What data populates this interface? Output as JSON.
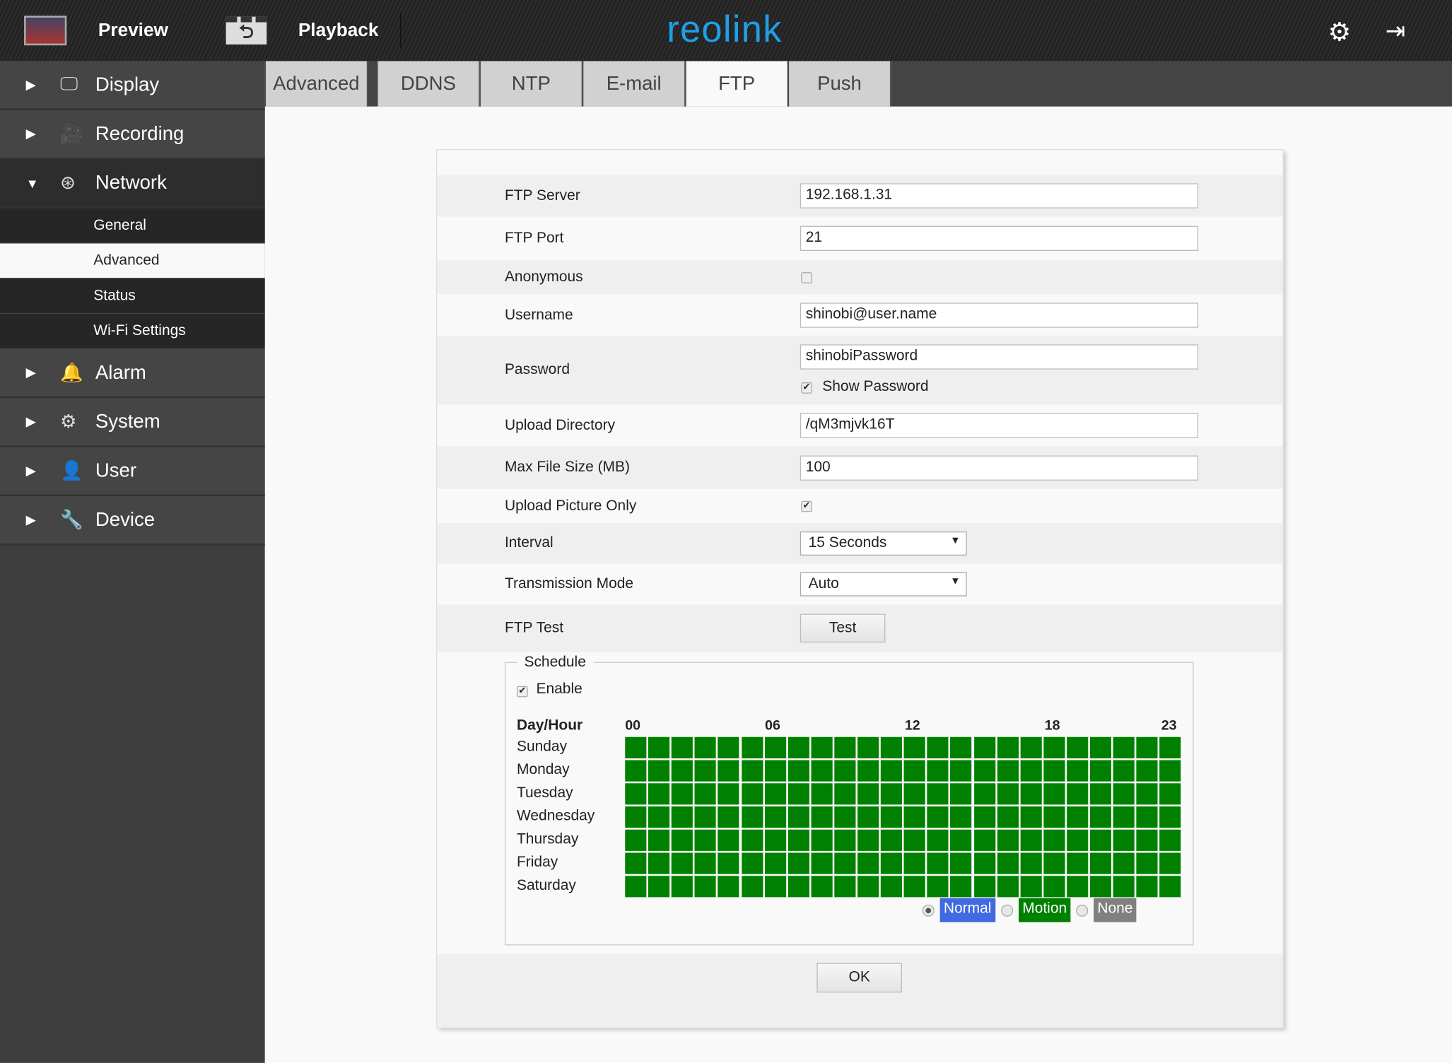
{
  "header": {
    "preview": "Preview",
    "playback": "Playback",
    "logo": "reolink"
  },
  "sidebar": {
    "items": [
      {
        "label": "Display",
        "icon": "monitor-icon"
      },
      {
        "label": "Recording",
        "icon": "camera-icon"
      },
      {
        "label": "Network",
        "icon": "network-icon",
        "expanded": true
      },
      {
        "label": "Alarm",
        "icon": "alarm-icon"
      },
      {
        "label": "System",
        "icon": "gears-icon"
      },
      {
        "label": "User",
        "icon": "user-icon"
      },
      {
        "label": "Device",
        "icon": "wrench-icon"
      }
    ],
    "network_sub": [
      "General",
      "Advanced",
      "Status",
      "Wi-Fi Settings"
    ],
    "selected_sub": "Advanced"
  },
  "tabs": [
    "Advanced",
    "DDNS",
    "NTP",
    "E-mail",
    "FTP",
    "Push"
  ],
  "active_tab": "FTP",
  "form": {
    "ftp_server_label": "FTP Server",
    "ftp_server": "192.168.1.31",
    "ftp_port_label": "FTP Port",
    "ftp_port": "21",
    "anonymous_label": "Anonymous",
    "anonymous": false,
    "username_label": "Username",
    "username": "shinobi@user.name",
    "password_label": "Password",
    "password": "shinobiPassword",
    "show_password_label": "Show Password",
    "show_password": true,
    "upload_dir_label": "Upload Directory",
    "upload_dir": "/qM3mjvk16T",
    "max_size_label": "Max File Size (MB)",
    "max_size": "100",
    "picture_only_label": "Upload Picture Only",
    "picture_only": true,
    "interval_label": "Interval",
    "interval": "15 Seconds",
    "mode_label": "Transmission Mode",
    "mode": "Auto",
    "test_label": "FTP Test",
    "test_button": "Test"
  },
  "schedule": {
    "legend": "Schedule",
    "enable_label": "Enable",
    "enabled": true,
    "header": "Day/Hour",
    "hour_labels": [
      "00",
      "06",
      "12",
      "18",
      "23"
    ],
    "days": [
      "Sunday",
      "Monday",
      "Tuesday",
      "Wednesday",
      "Thursday",
      "Friday",
      "Saturday"
    ],
    "fill": "motion",
    "modes": [
      {
        "label": "Normal",
        "color": "#4169e1",
        "selected": true
      },
      {
        "label": "Motion",
        "color": "#008000"
      },
      {
        "label": "None",
        "color": "#808080"
      }
    ]
  },
  "ok": "OK"
}
